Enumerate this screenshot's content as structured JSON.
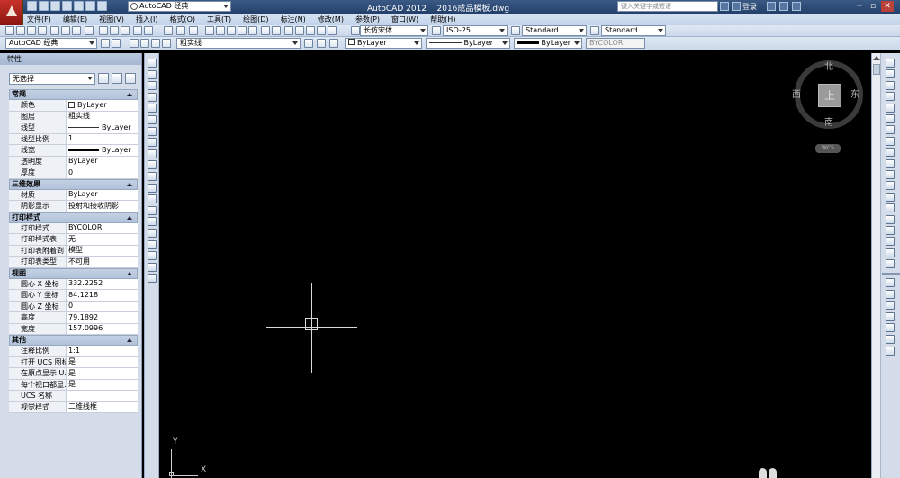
{
  "title_bar": {
    "workspace": "AutoCAD 经典",
    "app_title": "AutoCAD 2012",
    "file_name": "2016成品模板.dwg",
    "search_placeholder": "键入关键字或短语",
    "login": "登录"
  },
  "menu": [
    "文件(F)",
    "编辑(E)",
    "视图(V)",
    "插入(I)",
    "格式(O)",
    "工具(T)",
    "绘图(D)",
    "标注(N)",
    "修改(M)",
    "参数(P)",
    "窗口(W)",
    "帮助(H)"
  ],
  "toolbar": {
    "text_style": "长仿宋体",
    "dim_style": "ISO-25",
    "table_style": "Standard",
    "mleader_style": "Standard",
    "workspace": "AutoCAD 经典",
    "layer": "粗实线",
    "color": "ByLayer",
    "linetype": "ByLayer",
    "lineweight": "ByLayer",
    "plot_style": "BYCOLOR"
  },
  "properties": {
    "title": "特性",
    "selection": "无选择",
    "sections": [
      {
        "name": "常规",
        "rows": [
          {
            "k": "颜色",
            "v": "ByLayer"
          },
          {
            "k": "图层",
            "v": "粗实线"
          },
          {
            "k": "线型",
            "v": "ByLayer"
          },
          {
            "k": "线型比例",
            "v": "1"
          },
          {
            "k": "线宽",
            "v": "ByLayer"
          },
          {
            "k": "透明度",
            "v": "ByLayer"
          },
          {
            "k": "厚度",
            "v": "0"
          }
        ]
      },
      {
        "name": "三维效果",
        "rows": [
          {
            "k": "材质",
            "v": "ByLayer"
          },
          {
            "k": "阴影显示",
            "v": "投射和接收阴影"
          }
        ]
      },
      {
        "name": "打印样式",
        "rows": [
          {
            "k": "打印样式",
            "v": "BYCOLOR"
          },
          {
            "k": "打印样式表",
            "v": "无"
          },
          {
            "k": "打印表附着到",
            "v": "模型"
          },
          {
            "k": "打印表类型",
            "v": "不可用"
          }
        ]
      },
      {
        "name": "视图",
        "rows": [
          {
            "k": "圆心 X 坐标",
            "v": "332.2252"
          },
          {
            "k": "圆心 Y 坐标",
            "v": "84.1218"
          },
          {
            "k": "圆心 Z 坐标",
            "v": "0"
          },
          {
            "k": "高度",
            "v": "79.1892"
          },
          {
            "k": "宽度",
            "v": "157.0996"
          }
        ]
      },
      {
        "name": "其他",
        "rows": [
          {
            "k": "注释比例",
            "v": "1:1"
          },
          {
            "k": "打开 UCS 图标",
            "v": "是"
          },
          {
            "k": "在原点显示 U...",
            "v": "是"
          },
          {
            "k": "每个视口都显...",
            "v": "是"
          },
          {
            "k": "UCS 名称",
            "v": ""
          },
          {
            "k": "视觉样式",
            "v": "二维线框"
          }
        ]
      }
    ]
  },
  "viewcube": {
    "north": "北",
    "south": "南",
    "east": "东",
    "west": "西",
    "top": "上",
    "wcs": "WCS"
  },
  "ucs": {
    "x": "X",
    "y": "Y"
  }
}
